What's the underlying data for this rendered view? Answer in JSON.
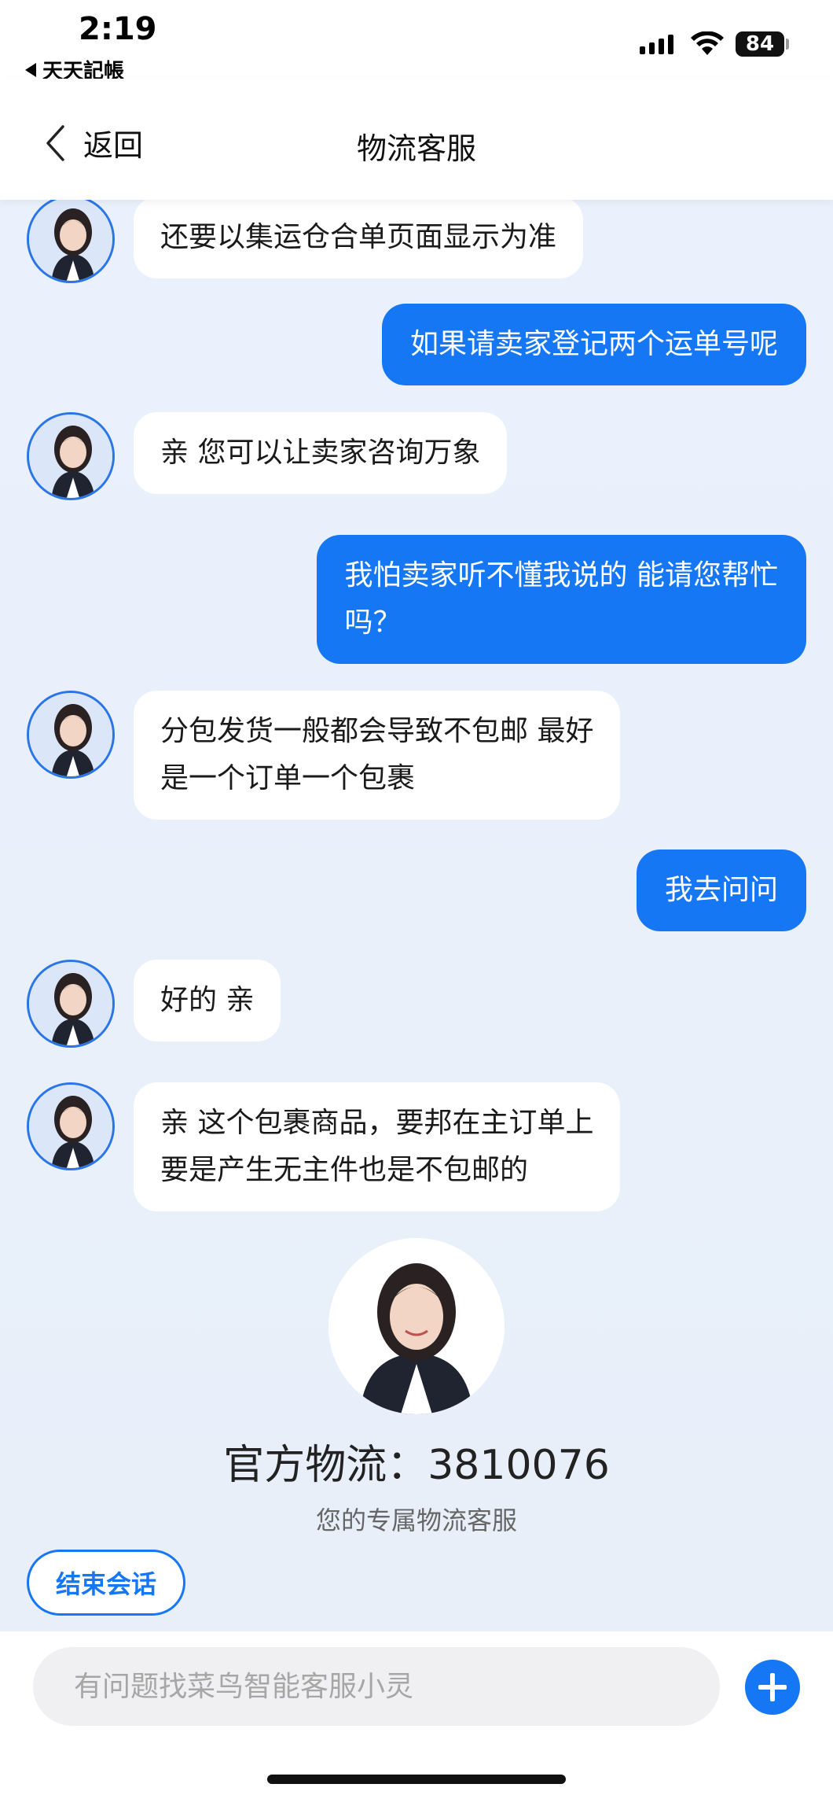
{
  "status_bar": {
    "time": "2:19",
    "back_app": "天天記帳",
    "battery": "84"
  },
  "nav": {
    "back_label": "返回",
    "title": "物流客服"
  },
  "messages": [
    {
      "from": "agent",
      "text": "还要以集运仓合单页面显示为准"
    },
    {
      "from": "user",
      "text": "如果请卖家登记两个运单号呢"
    },
    {
      "from": "agent",
      "text": "亲 您可以让卖家咨询万象"
    },
    {
      "from": "user",
      "line1": "我怕卖家听不懂我说的 能请您帮忙",
      "line2": "吗？"
    },
    {
      "from": "agent",
      "line1": "分包发货一般都会导致不包邮 最好",
      "line2": "是一个订单一个包裹"
    },
    {
      "from": "user",
      "text": "我去问问"
    },
    {
      "from": "agent",
      "text": "好的 亲"
    },
    {
      "from": "agent",
      "line1": "亲 这个包裹商品，要邦在主订单上",
      "line2": "要是产生无主件也是不包邮的"
    }
  ],
  "agent_card": {
    "name": "官方物流：3810076",
    "subtitle": "您的专属物流客服"
  },
  "end_session_label": "结束会话",
  "input": {
    "placeholder": "有问题找菜鸟智能客服小灵"
  },
  "colors": {
    "accent": "#1677f5",
    "background": "#e9f0fb"
  }
}
